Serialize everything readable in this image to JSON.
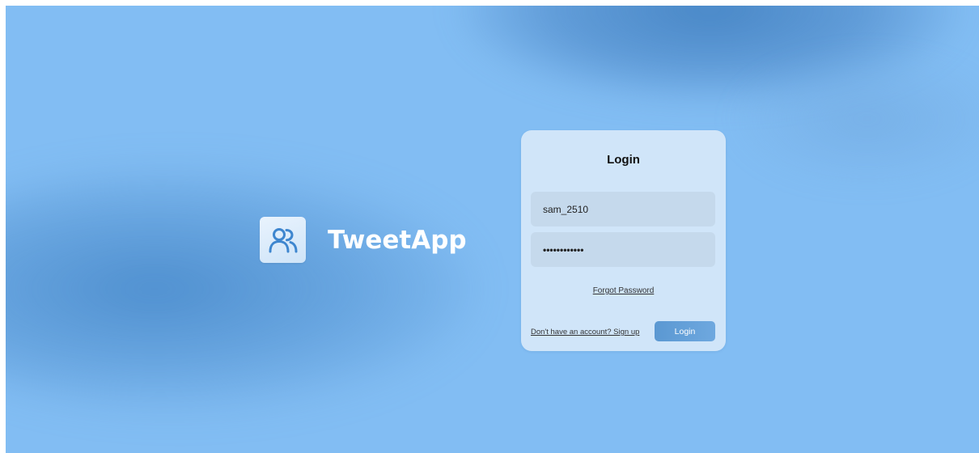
{
  "brand": {
    "name": "TweetApp",
    "logo_icon": "users-icon"
  },
  "login_form": {
    "title": "Login",
    "username": {
      "value": "sam_2510"
    },
    "password": {
      "value": "••••••••••••"
    },
    "forgot_password_label": "Forgot Password",
    "signup_link_label": "Don't have an account? Sign up",
    "submit_label": "Login"
  },
  "colors": {
    "background": "#82bdf3",
    "accent_button": "#5b98d2",
    "card": "#e2eefa",
    "input_fill": "#c5d9ec"
  }
}
